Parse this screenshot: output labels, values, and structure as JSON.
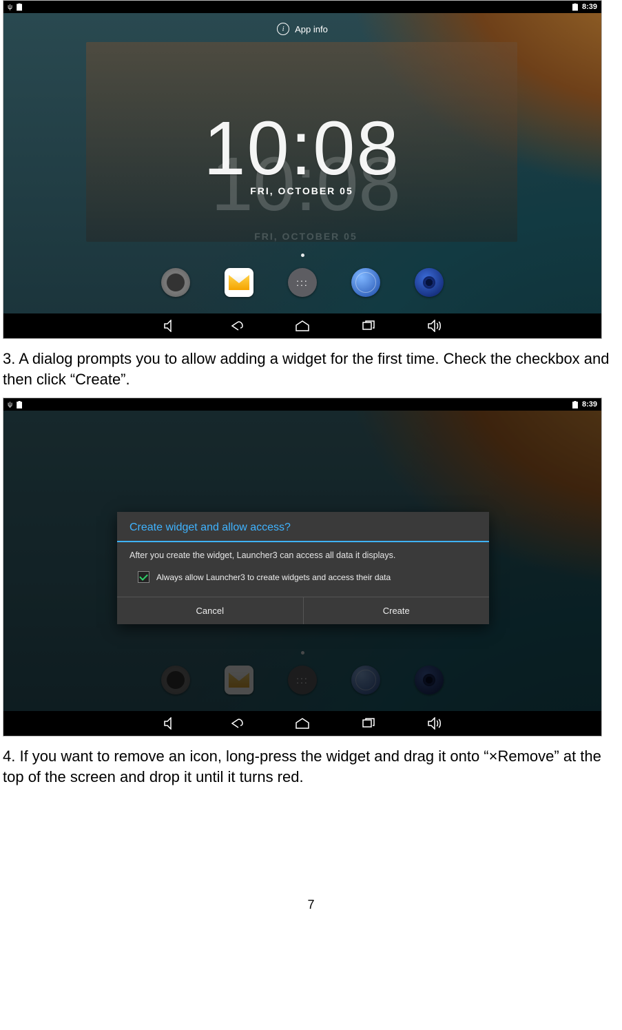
{
  "step3_text": "3. A dialog prompts you to allow adding a widget for the first time. Check the checkbox and then click “Create”.",
  "step4_text": "4. If you want to remove an icon, long-press the widget and drag it onto “×Remove” at the top of the screen and drop it until it turns red.",
  "page_number": "7",
  "status": {
    "time": "8:39"
  },
  "shot1": {
    "app_info_label": "App info",
    "clock_time": "10:08",
    "clock_date": "FRI, OCTOBER 05"
  },
  "dialog": {
    "title": "Create widget and allow access?",
    "body": "After you create the widget, Launcher3 can access all data it displays.",
    "check_label": "Always allow Launcher3 to create widgets and access their data",
    "cancel": "Cancel",
    "create": "Create"
  },
  "dock_icons": [
    "settings",
    "mail",
    "drawer",
    "browser",
    "music"
  ]
}
